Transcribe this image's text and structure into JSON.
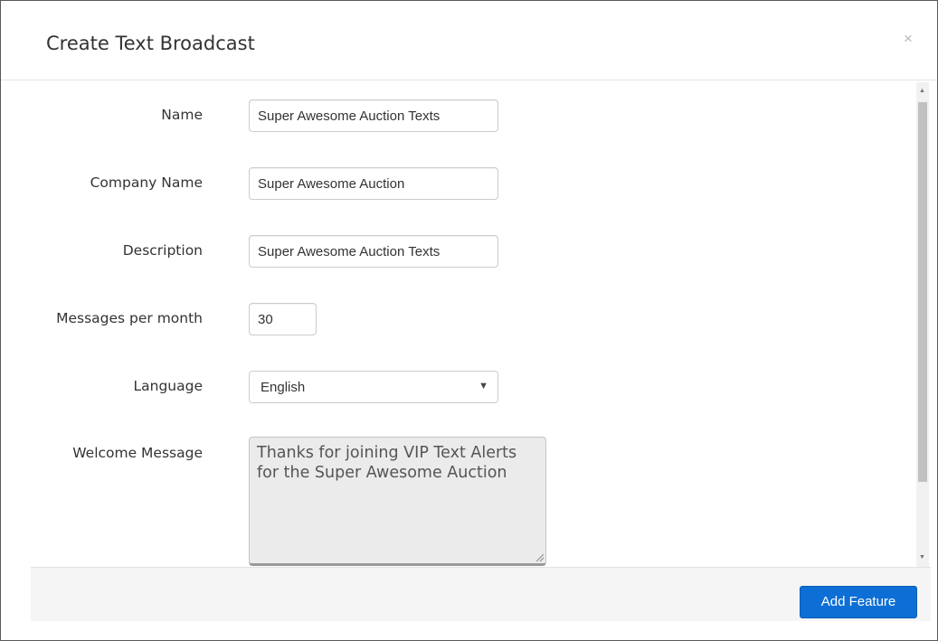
{
  "modal": {
    "title": "Create Text Broadcast",
    "close_glyph": "×"
  },
  "form": {
    "name": {
      "label": "Name",
      "value": "Super Awesome Auction Texts"
    },
    "company_name": {
      "label": "Company Name",
      "value": "Super Awesome Auction"
    },
    "description": {
      "label": "Description",
      "value": "Super Awesome Auction Texts"
    },
    "messages_per_month": {
      "label": "Messages per month",
      "value": "30"
    },
    "language": {
      "label": "Language",
      "selected": "English",
      "caret": "▼"
    },
    "welcome_message": {
      "label": "Welcome Message",
      "value": "Thanks for joining VIP Text Alerts for the Super Awesome Auction"
    }
  },
  "scrollbar": {
    "up_glyph": "▲",
    "down_glyph": "▼"
  },
  "footer": {
    "add_button_label": "Add Feature",
    "add_button_color": "#0d6fd6"
  }
}
